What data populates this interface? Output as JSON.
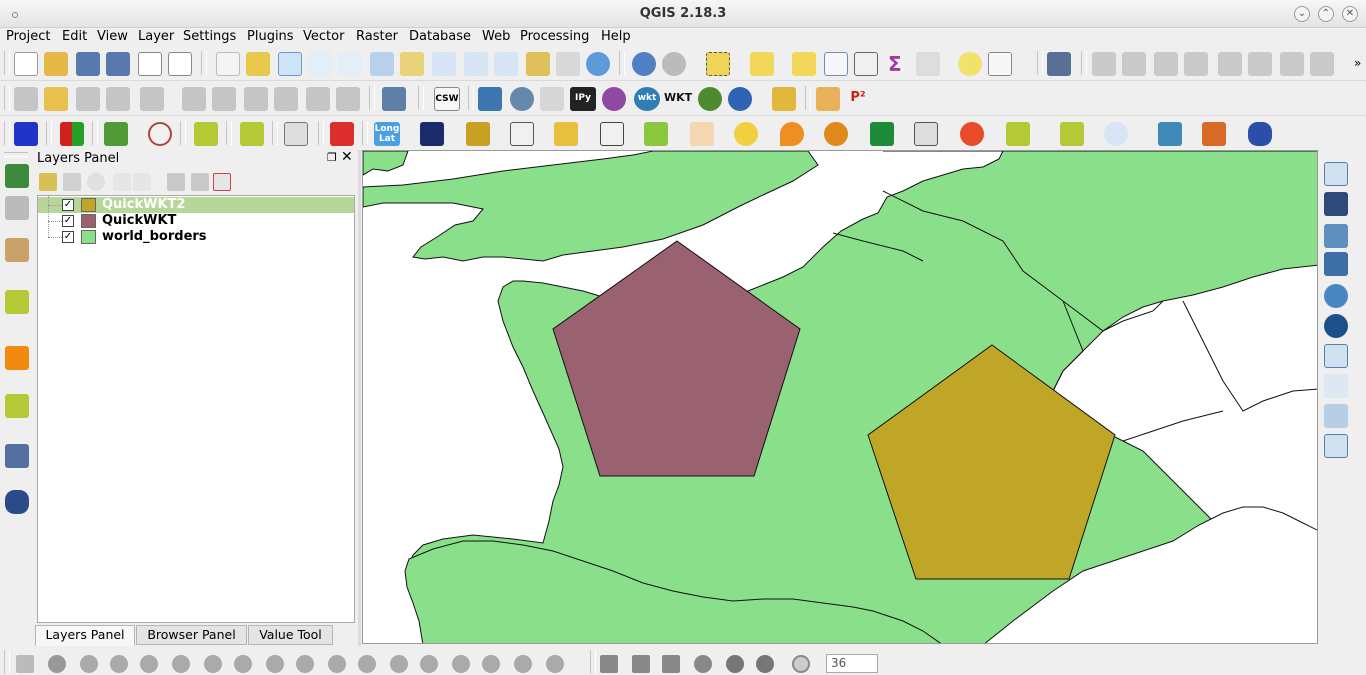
{
  "window": {
    "title": "QGIS 2.18.3"
  },
  "menu": [
    "Project",
    "Edit",
    "View",
    "Layer",
    "Settings",
    "Plugins",
    "Vector",
    "Raster",
    "Database",
    "Web",
    "Processing",
    "Help"
  ],
  "toolbar3": {
    "csw_label": "CSW",
    "ipy_label": "IPy",
    "wkt_label": "wkt",
    "wkt2_label": "WKT",
    "p2_label": "P²"
  },
  "toolbar4": {
    "longlat_label": "Long\nLat"
  },
  "layers_panel": {
    "title": "Layers Panel",
    "layers": [
      {
        "name": "QuickWKT2",
        "checked": true,
        "color": "#c0a626",
        "selected": true
      },
      {
        "name": "QuickWKT",
        "checked": true,
        "color": "#9a6171",
        "selected": false
      },
      {
        "name": "world_borders",
        "checked": true,
        "color": "#8ae08a",
        "selected": false
      }
    ],
    "tabs": [
      "Layers Panel",
      "Browser Panel",
      "Value Tool"
    ],
    "active_tab": "Layers Panel"
  },
  "map": {
    "land_color": "#8ae08a",
    "pentagon1_color": "#9a6171",
    "pentagon2_color": "#c0a626"
  },
  "statusbar": {
    "spin_value": "36"
  }
}
